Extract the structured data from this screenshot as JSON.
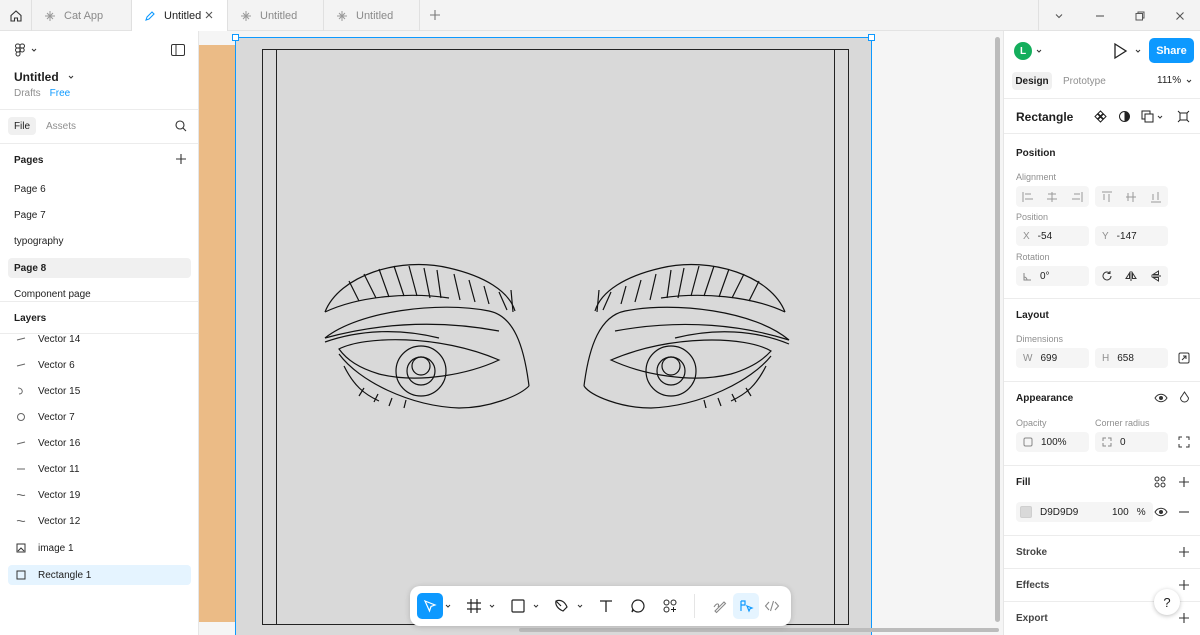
{
  "tabs": [
    {
      "label": "Cat App"
    },
    {
      "label": "Untitled"
    },
    {
      "label": "Untitled"
    },
    {
      "label": "Untitled"
    }
  ],
  "file": {
    "name": "Untitled",
    "location": "Drafts",
    "plan": "Free"
  },
  "left_tabs": {
    "file": "File",
    "assets": "Assets"
  },
  "pages": {
    "title": "Pages",
    "items": [
      "Page 6",
      "Page 7",
      "typography",
      "Page 8",
      "Component page"
    ]
  },
  "layers": {
    "title": "Layers",
    "items": [
      "Vector 14",
      "Vector 6",
      "Vector 15",
      "Vector 7",
      "Vector 16",
      "Vector 11",
      "Vector 19",
      "Vector 12",
      "image 1",
      "Rectangle 1"
    ]
  },
  "right": {
    "avatar_letter": "L",
    "share": "Share",
    "mode_tabs": {
      "design": "Design",
      "prototype": "Prototype"
    },
    "zoom": "111%",
    "selection": "Rectangle",
    "position": {
      "title": "Position",
      "alignment": "Alignment",
      "position": "Position",
      "x_label": "X",
      "x": "-54",
      "y_label": "Y",
      "y": "-147",
      "rotation": "Rotation",
      "rotation_value": "0°"
    },
    "layout": {
      "title": "Layout",
      "dimensions": "Dimensions",
      "w_label": "W",
      "w": "699",
      "h_label": "H",
      "h": "658"
    },
    "appearance": {
      "title": "Appearance",
      "opacity": "Opacity",
      "opacity_value": "100%",
      "corner_radius": "Corner radius",
      "corner_value": "0"
    },
    "fill": {
      "title": "Fill",
      "hex": "D9D9D9",
      "opacity": "100",
      "percent": "%"
    },
    "stroke": "Stroke",
    "effects": "Effects",
    "export": "Export"
  },
  "colors": {
    "accent": "#0d99ff",
    "selection": "#0d99ff",
    "fill": "#d9d9d9",
    "avatar": "#14ae5c",
    "image_strip": "#ebbb86"
  },
  "help": "?"
}
